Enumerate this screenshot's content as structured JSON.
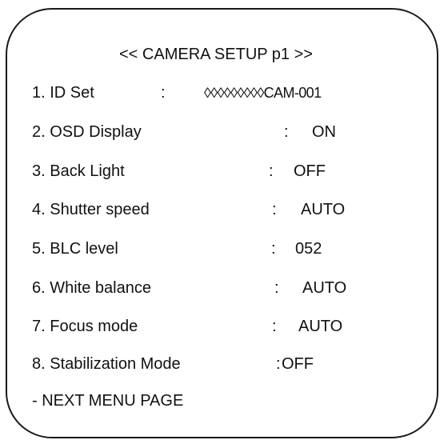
{
  "menu": {
    "title": "<< CAMERA SETUP p1 >>",
    "items": [
      {
        "label": "1. ID Set",
        "sep": ":",
        "value": "◊◊◊◊◊◊◊◊◊CAM-001"
      },
      {
        "label": "2. OSD Display",
        "sep": ":",
        "value": "ON"
      },
      {
        "label": "3. Back Light",
        "sep": ":",
        "value": "OFF"
      },
      {
        "label": "4. Shutter speed",
        "sep": ":",
        "value": "AUTO"
      },
      {
        "label": "5. BLC level",
        "sep": ":",
        "value": "052"
      },
      {
        "label": "6. White balance",
        "sep": ":",
        "value": "AUTO"
      },
      {
        "label": "7. Focus mode",
        "sep": ":",
        "value": "AUTO"
      },
      {
        "label": "8. Stabilization Mode",
        "sep": ":",
        "value": "OFF"
      }
    ],
    "next_page": "- NEXT MENU PAGE"
  }
}
